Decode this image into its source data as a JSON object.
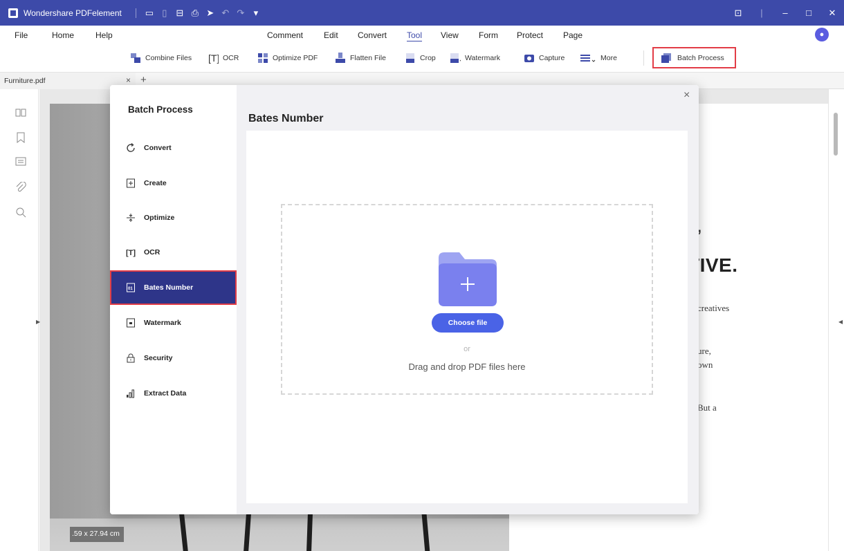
{
  "titlebar": {
    "app_name": "Wondershare PDFelement",
    "quick_access": [
      "open-folder-icon",
      "new-doc-icon",
      "save-icon",
      "print-icon",
      "forward-icon",
      "undo-icon",
      "redo-icon",
      "dropdown-icon"
    ],
    "window_controls": [
      "feedback-icon",
      "minimize-icon",
      "maximize-icon",
      "close-icon"
    ]
  },
  "menubar": {
    "left": [
      "File",
      "Home",
      "Help"
    ],
    "center": [
      "Comment",
      "Edit",
      "Convert",
      "Tool",
      "View",
      "Form",
      "Protect",
      "Page"
    ],
    "active": "Tool"
  },
  "toolbar": {
    "items": [
      "Combine Files",
      "OCR",
      "Optimize PDF",
      "Flatten File",
      "Crop",
      "Watermark",
      "Capture",
      "More"
    ],
    "batch_process_label": "Batch Process"
  },
  "tabs": {
    "document": "Furniture.pdf",
    "close": "×",
    "add": "+"
  },
  "document": {
    "page_size": ".59 x 27.94 cm",
    "headline_fragment": "TIVE.",
    "quote_fragment": "’",
    "lines": [
      "creatives",
      "ure,",
      "own",
      "But a"
    ]
  },
  "modal": {
    "sidebar_title": "Batch Process",
    "items": [
      "Convert",
      "Create",
      "Optimize",
      "OCR",
      "Bates Number",
      "Watermark",
      "Security",
      "Extract Data"
    ],
    "active_item": "Bates Number",
    "heading": "Bates Number",
    "choose_file_label": "Choose file",
    "or_label": "or",
    "drag_label": "Drag and drop PDF files here",
    "close": "×"
  },
  "colors": {
    "titlebar": "#3d4aa9",
    "accent": "#4a63e6",
    "active_item_bg": "#2e3589",
    "highlight_border": "#e23c46"
  }
}
